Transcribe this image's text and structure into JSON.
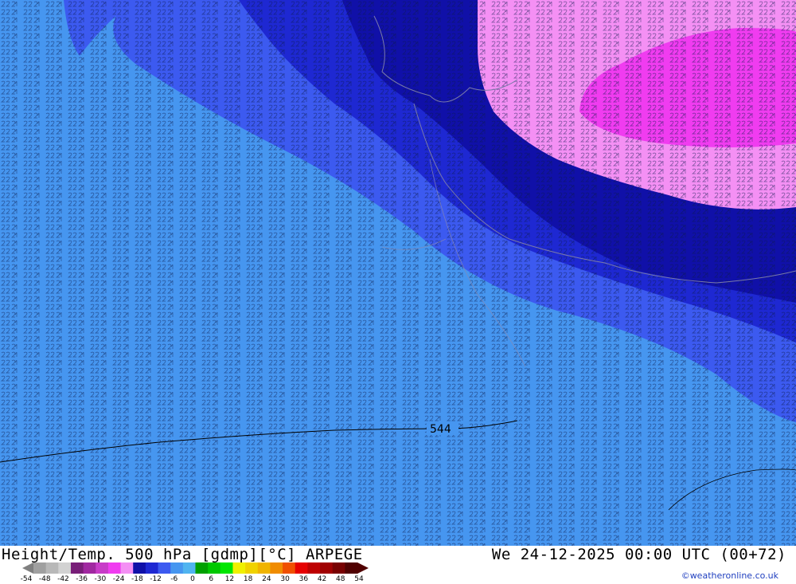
{
  "header": {
    "title_left": "Height/Temp. 500 hPa [gdmp][°C] ARPEGE",
    "title_right": "We 24-12-2025 00:00 UTC (00+72)"
  },
  "credit": "©weatheronline.co.uk",
  "map": {
    "contour_label": "544",
    "temperature_zones": [
      {
        "temp_c": -34,
        "color": "#f03cf0"
      },
      {
        "temp_c": -32,
        "color": "#f490f4"
      },
      {
        "temp_c": -28,
        "color": "#1010a8"
      },
      {
        "temp_c": -26,
        "color": "#1e28d2"
      },
      {
        "temp_c": -24,
        "color": "#3c5af0"
      },
      {
        "temp_c": -22,
        "color": "#4696f0"
      }
    ],
    "field_colors": {
      "ocean_base": "#3f8ef2",
      "pattern_ink": "#0a1a4a"
    }
  },
  "scale": {
    "labels": [
      "-54",
      "-48",
      "-42",
      "-36",
      "-30",
      "-24",
      "-18",
      "-12",
      "-6",
      "0",
      "6",
      "12",
      "18",
      "24",
      "30",
      "36",
      "42",
      "48",
      "54"
    ],
    "colors": [
      "#a0a0a0",
      "#b8b8b8",
      "#d2d2d2",
      "#781e78",
      "#a028a0",
      "#c83cc8",
      "#f03cf0",
      "#f490f4",
      "#1010a8",
      "#1e28d2",
      "#3c5af0",
      "#4696f0",
      "#50b4f0",
      "#00a000",
      "#00c800",
      "#00e600",
      "#f0f000",
      "#f0d200",
      "#f0b400",
      "#f08c00",
      "#f05000",
      "#e60000",
      "#be0000",
      "#a00000",
      "#780000",
      "#500000"
    ]
  }
}
